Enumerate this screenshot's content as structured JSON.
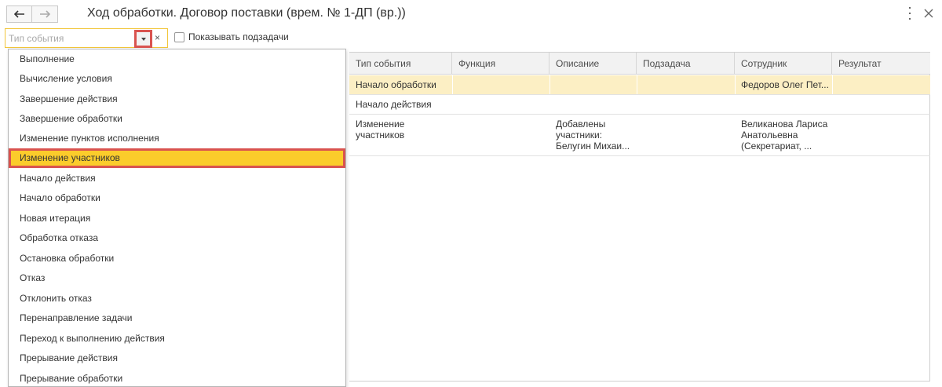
{
  "window": {
    "title": "Ход обработки. Договор поставки (врем. № 1-ДП (вр.))"
  },
  "filter": {
    "placeholder": "Тип события",
    "clear_symbol": "×",
    "show_subtasks_label": "Показывать подзадачи",
    "show_subtasks_checked": false
  },
  "table": {
    "columns": [
      "Тип события",
      "Функция",
      "Описание",
      "Подзадача",
      "Сотрудник",
      "Результат"
    ],
    "rows": [
      {
        "event_type": "Начало обработки",
        "function": "",
        "description": "",
        "subtask": "",
        "employee": "Федоров Олег Пет...",
        "result": "",
        "selected": true
      },
      {
        "event_type": "Начало действия",
        "function": "",
        "description": "",
        "subtask": "",
        "employee": "",
        "result": "",
        "selected": false
      },
      {
        "event_type": "Изменение\nучастников",
        "function": "",
        "description": "Добавлены\nучастники:\nБелугин Михаи...",
        "subtask": "",
        "employee": "Великанова Лариса\nАнатольевна\n(Секретариат, ...",
        "result": "",
        "selected": false
      }
    ]
  },
  "dropdown": {
    "highlighted_index": 5,
    "items": [
      "Выполнение",
      "Вычисление условия",
      "Завершение действия",
      "Завершение обработки",
      "Изменение пунктов исполнения",
      "Изменение участников",
      "Начало действия",
      "Начало обработки",
      "Новая итерация",
      "Обработка отказа",
      "Остановка обработки",
      "Отказ",
      "Отклонить отказ",
      "Перенаправление задачи",
      "Переход к выполнению действия",
      "Прерывание действия",
      "Прерывание обработки"
    ]
  },
  "colors": {
    "accent_yellow": "#fbcc2b",
    "selection_row": "#fcefc4",
    "highlight_border": "#d9534f",
    "input_border": "#f2c63a"
  },
  "icons": {
    "back": "arrow-left-icon",
    "forward": "arrow-right-icon",
    "more": "more-vertical-icon",
    "close": "close-icon",
    "dropdown": "chevron-down-icon"
  }
}
